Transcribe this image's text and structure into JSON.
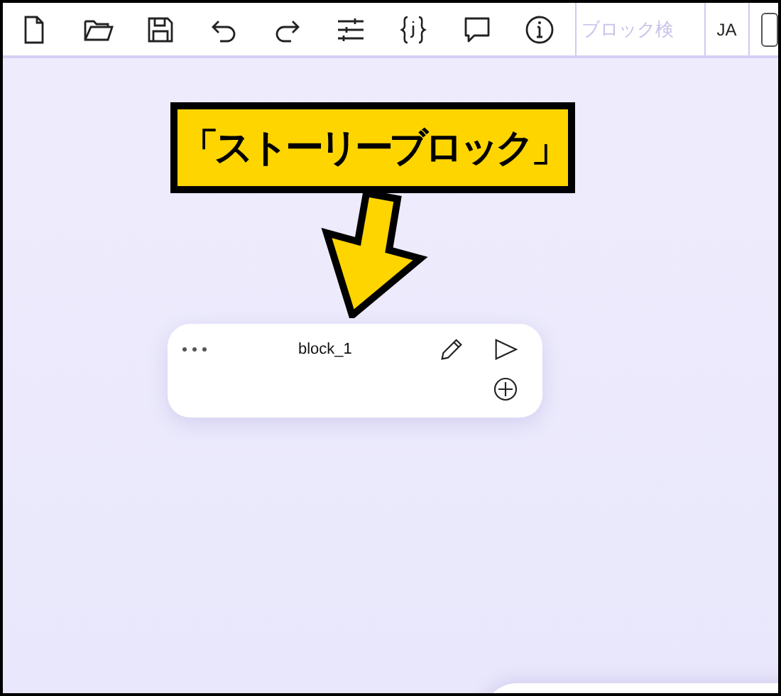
{
  "toolbar": {
    "search": {
      "placeholder": "ブロック検"
    },
    "language": "JA"
  },
  "callout": {
    "text": "「ストーリーブロック」"
  },
  "block": {
    "name": "block_1"
  }
}
